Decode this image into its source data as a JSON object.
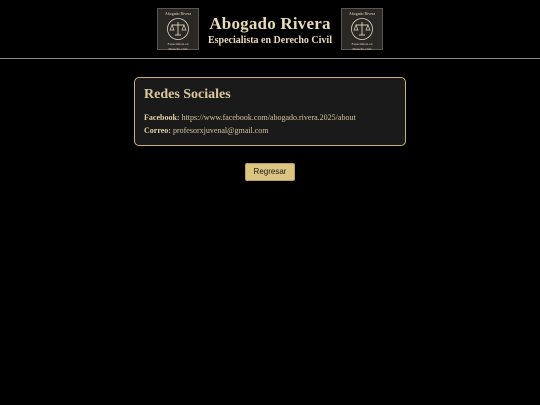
{
  "header": {
    "logo_top_text": "Abogado Rivera",
    "logo_bottom_text_1": "Especialista en",
    "logo_bottom_text_2": "Derecho civil",
    "title": "Abogado Rivera",
    "subtitle": "Especialista en Derecho Civil"
  },
  "card": {
    "heading": "Redes Sociales",
    "facebook_label": "Facebook:",
    "facebook_value": "https://www.facebook.com/abogado.rivera.2025/about",
    "email_label": "Correo:",
    "email_value": "profesorxjuvenal@gmail.com"
  },
  "actions": {
    "back_label": "Regresar"
  },
  "colors": {
    "background": "#000000",
    "accent": "#c7b07a",
    "button": "#dcc482"
  },
  "icons": [
    "scales-of-justice-icon"
  ]
}
